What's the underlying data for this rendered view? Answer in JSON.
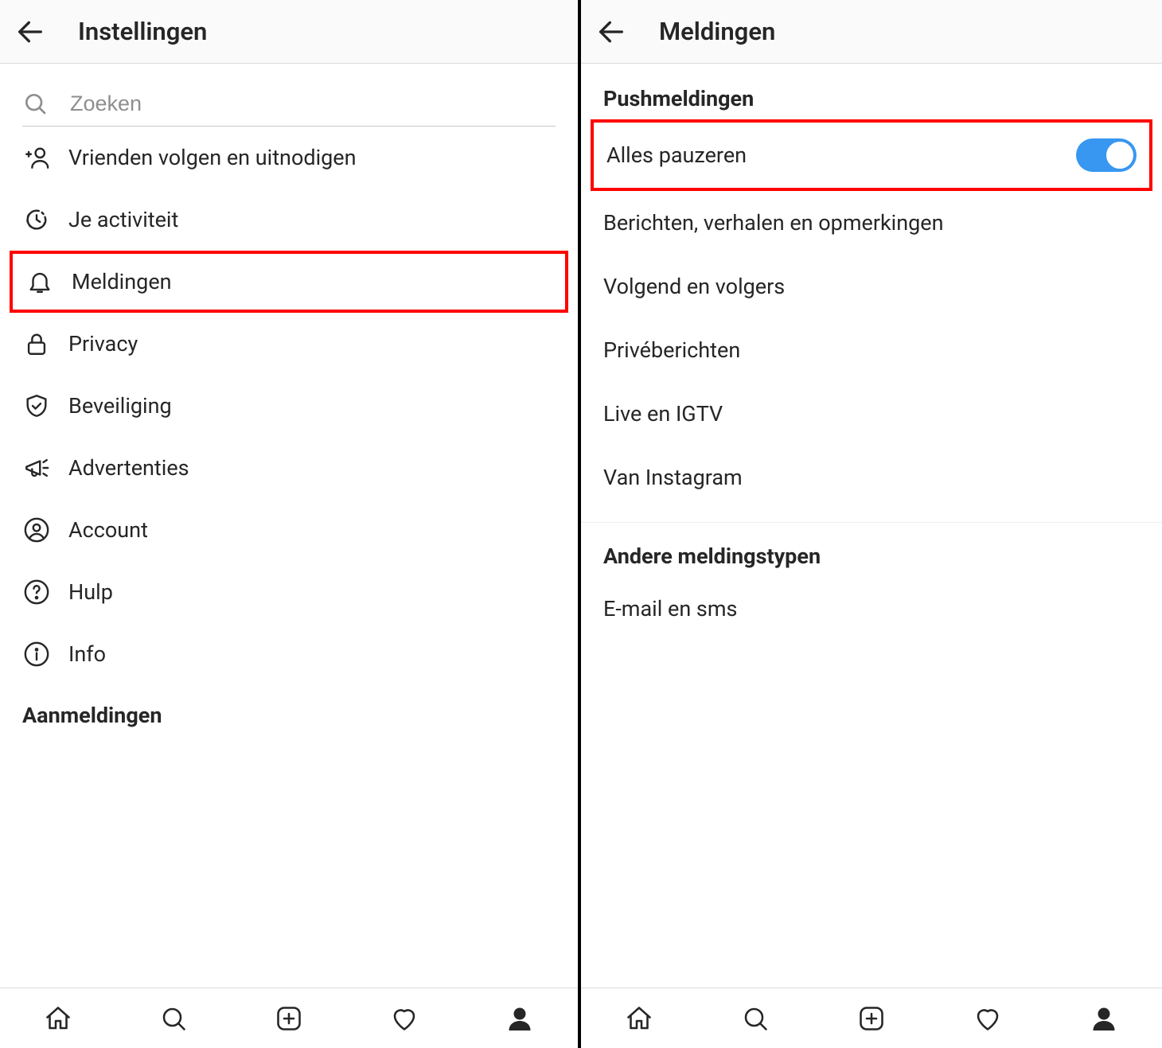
{
  "left": {
    "header_title": "Instellingen",
    "search_placeholder": "Zoeken",
    "items": [
      {
        "label": "Vrienden volgen en uitnodigen",
        "icon": "add-person-icon"
      },
      {
        "label": "Je activiteit",
        "icon": "activity-icon"
      },
      {
        "label": "Meldingen",
        "icon": "bell-icon"
      },
      {
        "label": "Privacy",
        "icon": "lock-icon"
      },
      {
        "label": "Beveiliging",
        "icon": "shield-check-icon"
      },
      {
        "label": "Advertenties",
        "icon": "megaphone-icon"
      },
      {
        "label": "Account",
        "icon": "account-circle-icon"
      },
      {
        "label": "Hulp",
        "icon": "help-circle-icon"
      },
      {
        "label": "Info",
        "icon": "info-circle-icon"
      }
    ],
    "section_heading": "Aanmeldingen"
  },
  "right": {
    "header_title": "Meldingen",
    "section1_heading": "Pushmeldingen",
    "pause_all_label": "Alles pauzeren",
    "items1": [
      "Berichten, verhalen en opmerkingen",
      "Volgend en volgers",
      "Privéberichten",
      "Live en IGTV",
      "Van Instagram"
    ],
    "section2_heading": "Andere meldingstypen",
    "items2": [
      "E-mail en sms"
    ]
  }
}
